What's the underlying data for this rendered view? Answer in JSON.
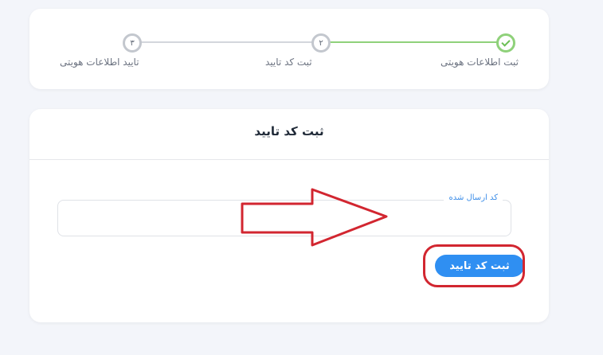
{
  "stepper": {
    "steps": [
      {
        "label": "ثبت اطلاعات هویتی",
        "state": "done"
      },
      {
        "label": "ثبت کد تایید",
        "number": "۲",
        "state": "current"
      },
      {
        "label": "تایید اطلاعات هویتی",
        "number": "۳",
        "state": "pending"
      }
    ]
  },
  "form": {
    "title": "ثبت کد تایید",
    "code_field": {
      "label": "کد ارسال شده",
      "value": "",
      "placeholder": ""
    },
    "submit_label": "ثبت کد تایید"
  },
  "colors": {
    "accent": "#2f8ff2",
    "done": "#8fd17a",
    "annotation": "#d22630"
  }
}
